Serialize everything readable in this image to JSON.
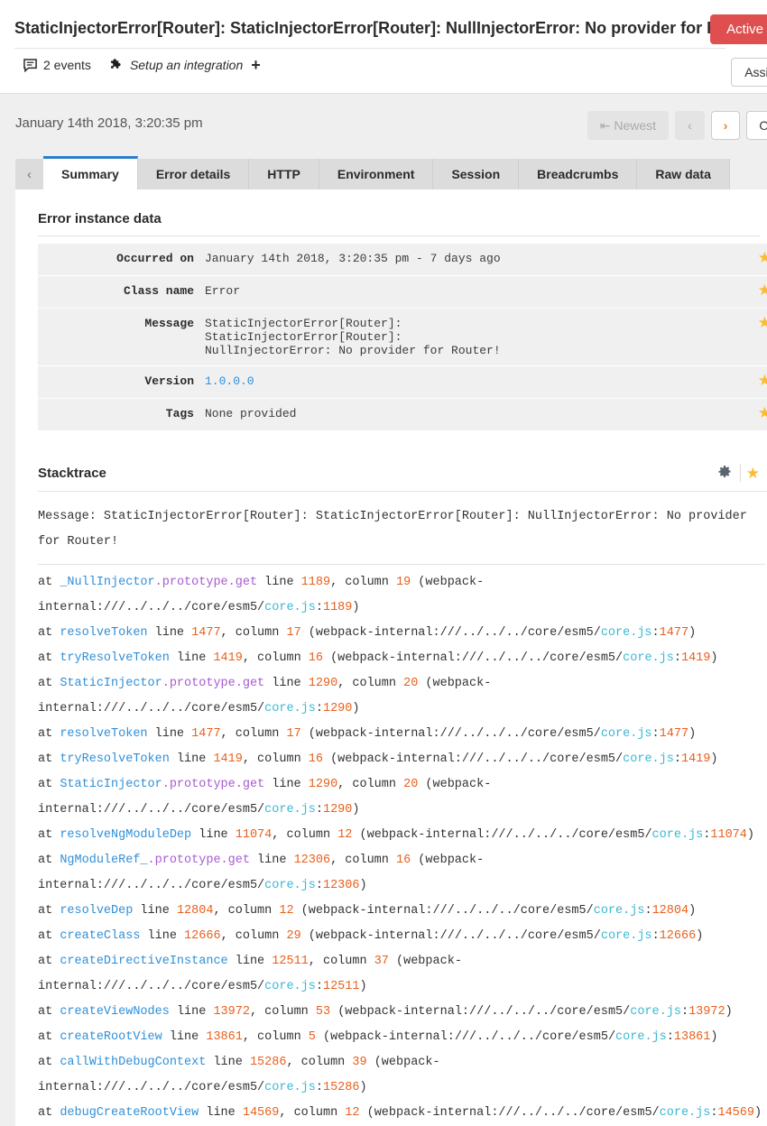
{
  "header": {
    "issue_title": "StaticInjectorError[Router]: StaticInjectorError[Router]: NullInjectorError: No provider for Rout..",
    "status_badge": "Active",
    "assign_button": "Assign t",
    "events_count": "2 events",
    "integration_link": "Setup an integration",
    "plus_glyph": "+",
    "comment_icon": "comment-icon",
    "puzzle_icon": "puzzle-piece-icon"
  },
  "subnav": {
    "event_date": "January 14th 2018, 3:20:35 pm",
    "pager": {
      "newest": "Newest",
      "prev": "‹",
      "next": "›",
      "oldest": "Oldes"
    }
  },
  "tabs": {
    "scroll_left": "‹",
    "items": [
      {
        "label": "Summary",
        "active": true
      },
      {
        "label": "Error details",
        "active": false
      },
      {
        "label": "HTTP",
        "active": false
      },
      {
        "label": "Environment",
        "active": false
      },
      {
        "label": "Session",
        "active": false
      },
      {
        "label": "Breadcrumbs",
        "active": false
      },
      {
        "label": "Raw data",
        "active": false
      }
    ]
  },
  "error_instance": {
    "section_title": "Error instance data",
    "rows": [
      {
        "key": "Occurred on",
        "value": "January 14th 2018, 3:20:35 pm - 7 days ago",
        "is_link": false
      },
      {
        "key": "Class name",
        "value": "Error",
        "is_link": false
      },
      {
        "key": "Message",
        "value": "StaticInjectorError[Router]:\nStaticInjectorError[Router]:\nNullInjectorError: No provider for Router!",
        "is_link": false
      },
      {
        "key": "Version",
        "value": "1.0.0.0",
        "is_link": true
      },
      {
        "key": "Tags",
        "value": "None provided",
        "is_link": false
      }
    ]
  },
  "stacktrace": {
    "section_title": "Stacktrace",
    "gear_icon": "gear-icon",
    "star_icon": "star-icon",
    "message": "Message: StaticInjectorError[Router]: StaticInjectorError[Router]: NullInjectorError: No provider for Router!",
    "frames": [
      {
        "fn": "_NullInjector",
        "proto": ".prototype.get",
        "line": "1189",
        "column": "19",
        "path_pre": "(webpack-internal:///../../../core/esm5/",
        "file": "core.js",
        "file_line": "1189"
      },
      {
        "fn": "resolveToken",
        "proto": "",
        "line": "1477",
        "column": "17",
        "path_pre": "(webpack-internal:///../../../core/esm5/",
        "file": "core.js",
        "file_line": "1477"
      },
      {
        "fn": "tryResolveToken",
        "proto": "",
        "line": "1419",
        "column": "16",
        "path_pre": "(webpack-internal:///../../../core/esm5/",
        "file": "core.js",
        "file_line": "1419"
      },
      {
        "fn": "StaticInjector",
        "proto": ".prototype.get",
        "line": "1290",
        "column": "20",
        "path_pre": "(webpack-internal:///../../../core/esm5/",
        "file": "core.js",
        "file_line": "1290"
      },
      {
        "fn": "resolveToken",
        "proto": "",
        "line": "1477",
        "column": "17",
        "path_pre": "(webpack-internal:///../../../core/esm5/",
        "file": "core.js",
        "file_line": "1477"
      },
      {
        "fn": "tryResolveToken",
        "proto": "",
        "line": "1419",
        "column": "16",
        "path_pre": "(webpack-internal:///../../../core/esm5/",
        "file": "core.js",
        "file_line": "1419"
      },
      {
        "fn": "StaticInjector",
        "proto": ".prototype.get",
        "line": "1290",
        "column": "20",
        "path_pre": "(webpack-internal:///../../../core/esm5/",
        "file": "core.js",
        "file_line": "1290"
      },
      {
        "fn": "resolveNgModuleDep",
        "proto": "",
        "line": "11074",
        "column": "12",
        "path_pre": "(webpack-internal:///../../../core/esm5/",
        "file": "core.js",
        "file_line": "11074"
      },
      {
        "fn": "NgModuleRef_",
        "proto": ".prototype.get",
        "line": "12306",
        "column": "16",
        "path_pre": "(webpack-internal:///../../../core/esm5/",
        "file": "core.js",
        "file_line": "12306"
      },
      {
        "fn": "resolveDep",
        "proto": "",
        "line": "12804",
        "column": "12",
        "path_pre": "(webpack-internal:///../../../core/esm5/",
        "file": "core.js",
        "file_line": "12804"
      },
      {
        "fn": "createClass",
        "proto": "",
        "line": "12666",
        "column": "29",
        "path_pre": "(webpack-internal:///../../../core/esm5/",
        "file": "core.js",
        "file_line": "12666"
      },
      {
        "fn": "createDirectiveInstance",
        "proto": "",
        "line": "12511",
        "column": "37",
        "path_pre": "(webpack-internal:///../../../core/esm5/",
        "file": "core.js",
        "file_line": "12511"
      },
      {
        "fn": "createViewNodes",
        "proto": "",
        "line": "13972",
        "column": "53",
        "path_pre": "(webpack-internal:///../../../core/esm5/",
        "file": "core.js",
        "file_line": "13972"
      },
      {
        "fn": "createRootView",
        "proto": "",
        "line": "13861",
        "column": "5",
        "path_pre": "(webpack-internal:///../../../core/esm5/",
        "file": "core.js",
        "file_line": "13861"
      },
      {
        "fn": "callWithDebugContext",
        "proto": "",
        "line": "15286",
        "column": "39",
        "path_pre": "(webpack-internal:///../../../core/esm5/",
        "file": "core.js",
        "file_line": "15286"
      },
      {
        "fn": "debugCreateRootView",
        "proto": "",
        "line": "14569",
        "column": "12",
        "path_pre": "(webpack-internal:///../../../core/esm5/",
        "file": "core.js",
        "file_line": "14569"
      }
    ],
    "keyword_at": "at",
    "keyword_line": "line",
    "keyword_column": "column"
  },
  "colors": {
    "accent_blue": "#2a7fc9",
    "status_red": "#e04f4f",
    "star_gold": "#fcbb30",
    "fn_blue": "#2f8fd8",
    "proto_purple": "#a65bd0",
    "num_orange": "#e8601c",
    "file_cyan": "#3bb7d4"
  }
}
